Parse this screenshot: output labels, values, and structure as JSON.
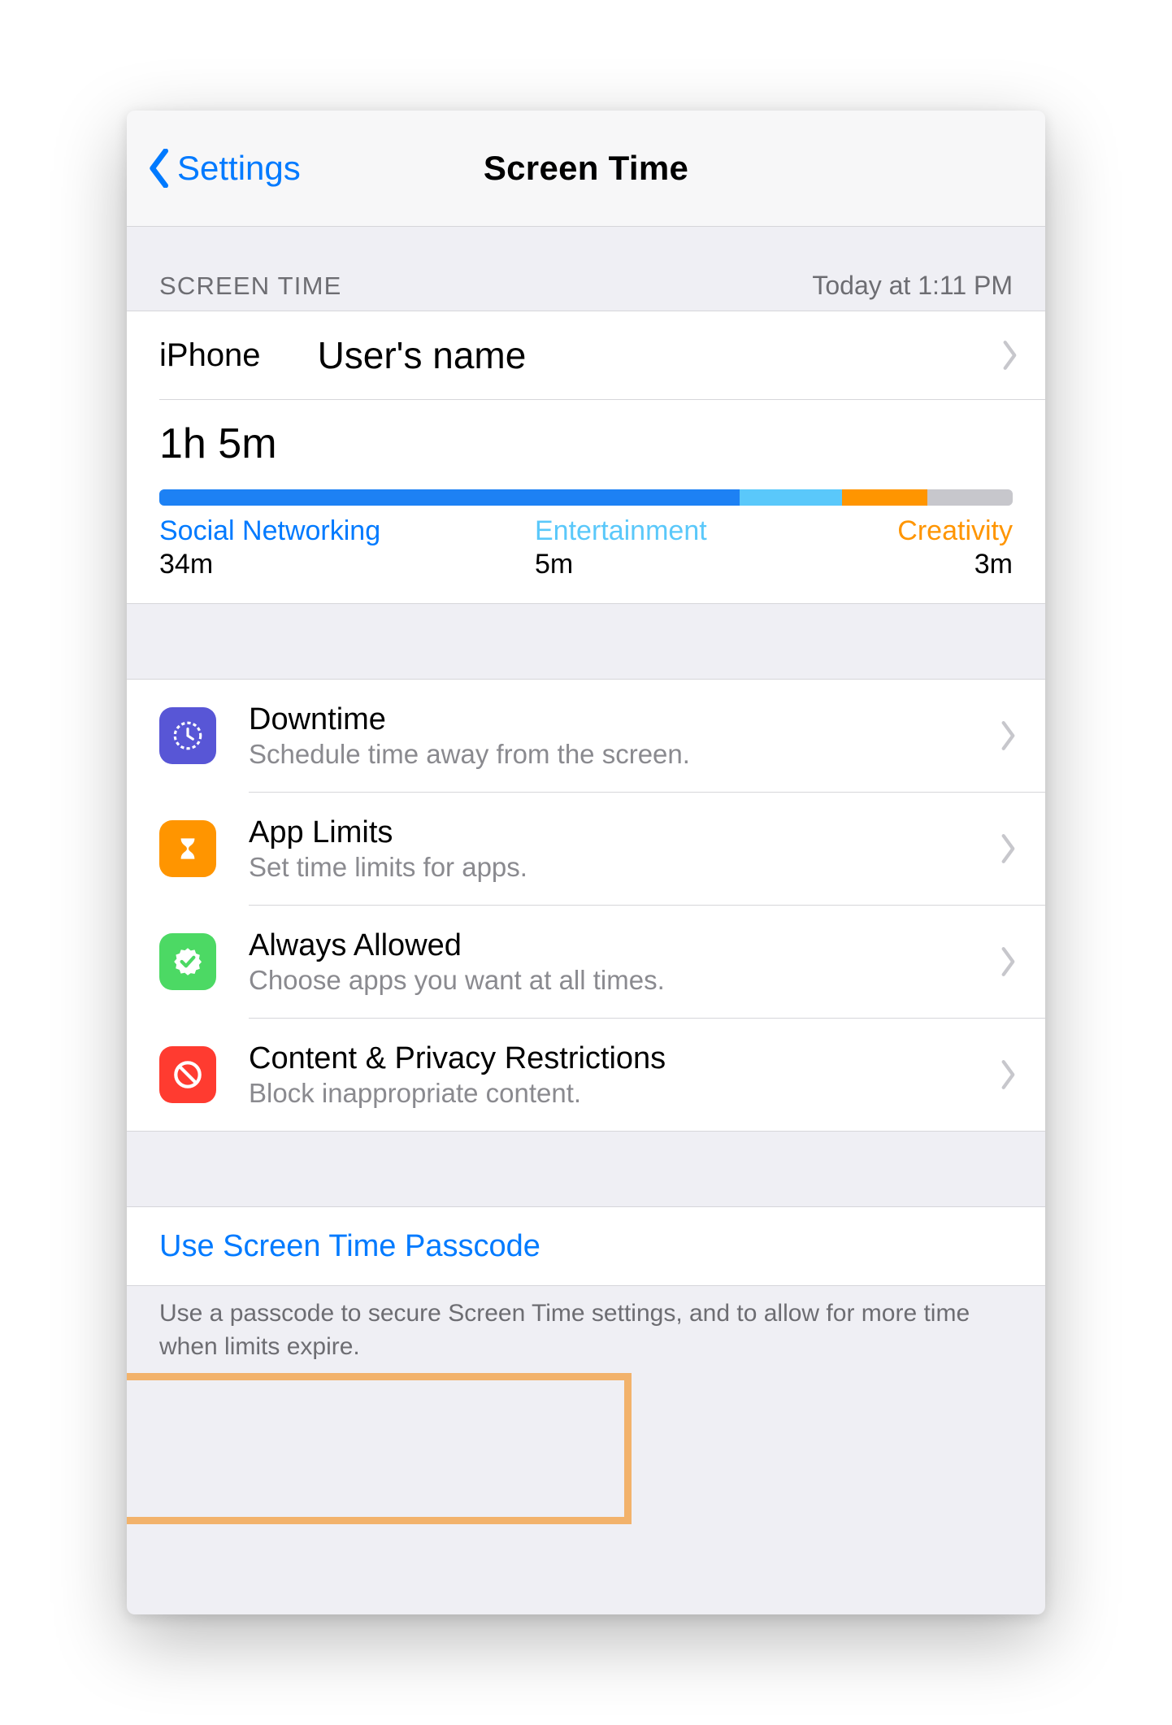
{
  "nav": {
    "back_label": "Settings",
    "title": "Screen Time"
  },
  "header": {
    "label": "SCREEN TIME",
    "timestamp": "Today at 1:11 PM"
  },
  "device_row": {
    "device": "iPhone",
    "username": "User's name"
  },
  "usage": {
    "total": "1h 5m",
    "bar_segments": [
      {
        "color": "blue",
        "pct": 68
      },
      {
        "color": "cyan",
        "pct": 12
      },
      {
        "color": "orange",
        "pct": 10
      },
      {
        "color": "grey",
        "pct": 10
      }
    ],
    "categories": [
      {
        "name": "Social Networking",
        "time": "34m"
      },
      {
        "name": "Entertainment",
        "time": "5m"
      },
      {
        "name": "Creativity",
        "time": "3m"
      }
    ]
  },
  "options": [
    {
      "title": "Downtime",
      "sub": "Schedule time away from the screen.",
      "icon": "clock-icon",
      "color": "purple"
    },
    {
      "title": "App Limits",
      "sub": "Set time limits for apps.",
      "icon": "hourglass-icon",
      "color": "orange"
    },
    {
      "title": "Always Allowed",
      "sub": "Choose apps you want at all times.",
      "icon": "badge-check-icon",
      "color": "green"
    },
    {
      "title": "Content & Privacy Restrictions",
      "sub": "Block inappropriate content.",
      "icon": "no-entry-icon",
      "color": "red"
    }
  ],
  "passcode": {
    "button": "Use Screen Time Passcode",
    "footer": "Use a passcode to secure Screen Time settings, and to allow for more time when limits expire."
  }
}
